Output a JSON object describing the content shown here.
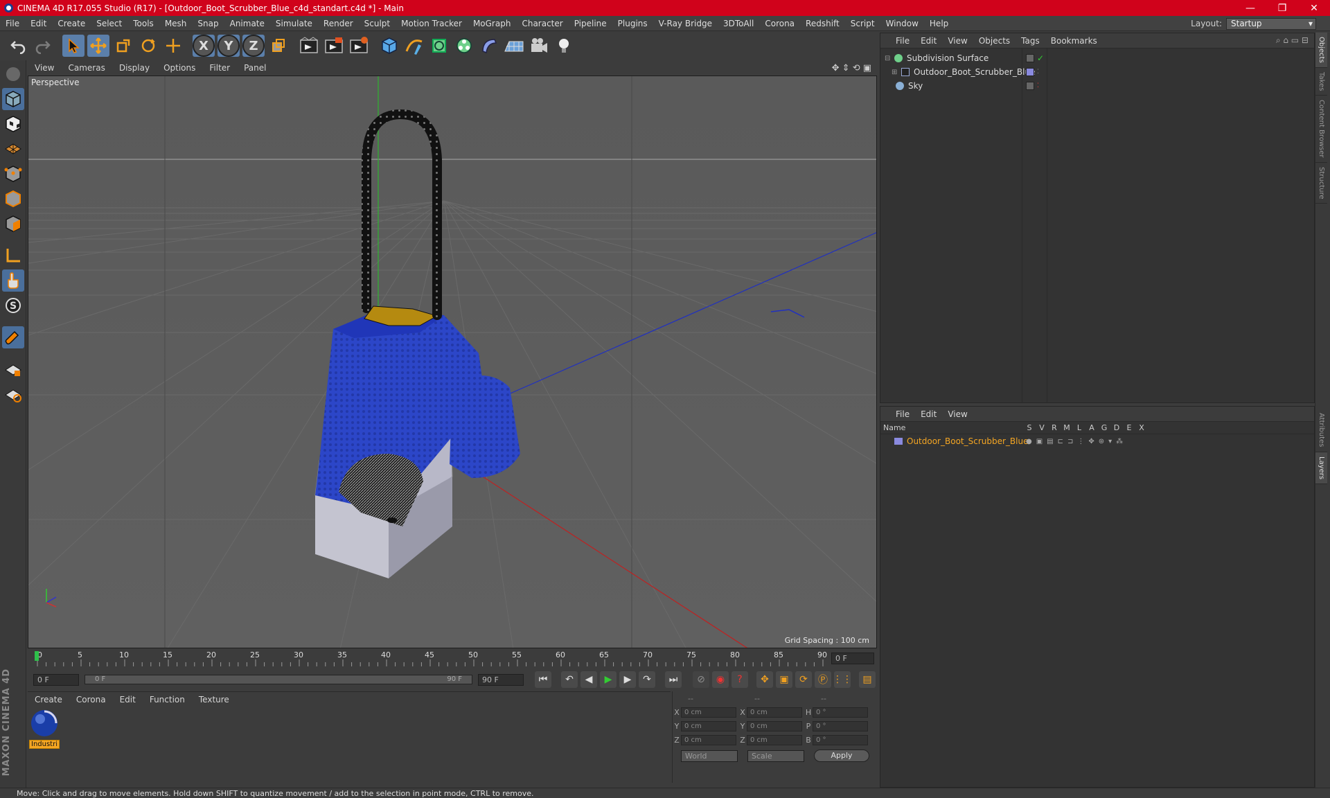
{
  "window": {
    "title": "CINEMA 4D R17.055 Studio (R17) - [Outdoor_Boot_Scrubber_Blue_c4d_standart.c4d *] - Main",
    "controls": [
      "—",
      "❐",
      "✕"
    ]
  },
  "menubar": {
    "items": [
      "File",
      "Edit",
      "Create",
      "Select",
      "Tools",
      "Mesh",
      "Snap",
      "Animate",
      "Simulate",
      "Render",
      "Sculpt",
      "Motion Tracker",
      "MoGraph",
      "Character",
      "Pipeline",
      "Plugins",
      "V-Ray Bridge",
      "3DToAll",
      "Corona",
      "Redshift",
      "Script",
      "Window",
      "Help"
    ],
    "layout_label": "Layout:",
    "layout_value": "Startup"
  },
  "toolbar": {
    "icons": [
      "undo-icon",
      "redo-icon",
      "select-arrow-icon",
      "move-icon",
      "scale-icon",
      "rotate-icon",
      "move-plus-icon",
      "x-axis-icon",
      "y-axis-icon",
      "z-axis-icon",
      "coordinate-system-icon",
      "render-view-icon",
      "render-picture-viewer-icon",
      "edit-render-settings-icon",
      "cube-icon",
      "pen-spline-icon",
      "subdivision-icon",
      "mograph-cloner-icon",
      "deformer-icon",
      "floor-icon",
      "camera-icon",
      "light-icon"
    ],
    "axis_x": "X",
    "axis_y": "Y",
    "axis_z": "Z"
  },
  "viewport": {
    "menu": [
      "View",
      "Cameras",
      "Display",
      "Options",
      "Filter",
      "Panel"
    ],
    "label": "Perspective",
    "grid_spacing": "Grid Spacing : 100 cm"
  },
  "timeline": {
    "ticks": [
      "0",
      "5",
      "10",
      "15",
      "20",
      "25",
      "30",
      "35",
      "40",
      "45",
      "50",
      "55",
      "60",
      "65",
      "70",
      "75",
      "80",
      "85",
      "90"
    ],
    "current_frame": "0 F",
    "start_field": "0 F",
    "range_start": "0 F",
    "range_end": "90 F",
    "end_field": "90 F"
  },
  "material_manager": {
    "menu": [
      "Create",
      "Corona",
      "Edit",
      "Function",
      "Texture"
    ],
    "material_name": "Industri"
  },
  "coordinates": {
    "headers": [
      "--",
      "--",
      "--"
    ],
    "rows": [
      {
        "a": "X",
        "v1": "0 cm",
        "b": "X",
        "v2": "0 cm",
        "c": "H",
        "v3": "0 °"
      },
      {
        "a": "Y",
        "v1": "0 cm",
        "b": "Y",
        "v2": "0 cm",
        "c": "P",
        "v3": "0 °"
      },
      {
        "a": "Z",
        "v1": "0 cm",
        "b": "Z",
        "v2": "0 cm",
        "c": "B",
        "v3": "0 °"
      }
    ],
    "world": "World",
    "scale": "Scale",
    "apply": "Apply"
  },
  "object_manager": {
    "menu": [
      "File",
      "Edit",
      "View",
      "Objects",
      "Tags",
      "Bookmarks"
    ],
    "objects": [
      {
        "name": "Subdivision Surface",
        "color": "#6fd08a"
      },
      {
        "name": "Outdoor_Boot_Scrubber_Blue",
        "color": "#9aa9d6"
      },
      {
        "name": "Sky",
        "color": "#8ab0d6"
      }
    ]
  },
  "layer_manager": {
    "menu": [
      "File",
      "Edit",
      "View"
    ],
    "columns": [
      "Name",
      "S",
      "V",
      "R",
      "M",
      "L",
      "A",
      "G",
      "D",
      "E",
      "X"
    ],
    "layer_name": "Outdoor_Boot_Scrubber_Blue",
    "layer_color": "#f5a623"
  },
  "right_tabs": [
    "Objects",
    "Takes",
    "Content Browser",
    "Structure",
    "Attributes",
    "Layers"
  ],
  "status": "Move: Click and drag to move elements. Hold down SHIFT to quantize movement / add to the selection in point mode, CTRL to remove.",
  "brand": "MAXON CINEMA 4D"
}
